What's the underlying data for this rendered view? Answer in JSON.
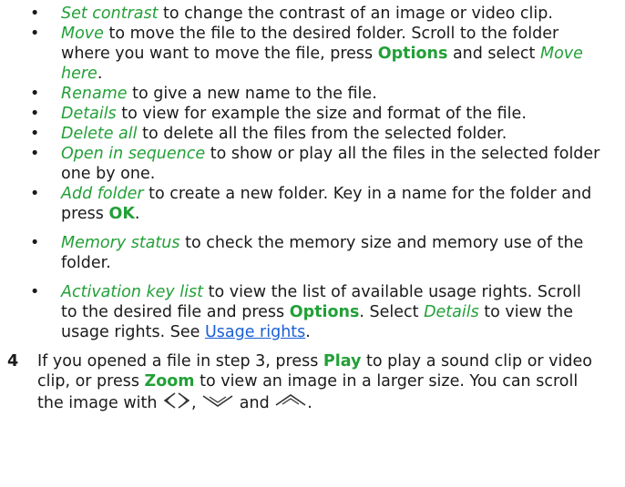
{
  "bullet_glyph": "•",
  "items": [
    {
      "option": "Set contrast",
      "text": " to change the contrast of an image or video clip."
    },
    {
      "option": "Move",
      "text1": " to move the file to the desired folder. Scroll to the folder where you want to move the file, press ",
      "key": "Options",
      "text2": " and select ",
      "option2": "Move here",
      "text3": "."
    },
    {
      "option": "Rename",
      "text": " to give a new name to the file."
    },
    {
      "option": "Details",
      "text": " to view for example the size and format of the file."
    },
    {
      "option": "Delete all",
      "text": " to delete all the files from the selected folder."
    },
    {
      "option": "Open in sequence",
      "text": " to show or play all the files in the selected folder one by one."
    },
    {
      "option": "Add folder",
      "text1": " to create a new folder. Key in a name for the folder and press ",
      "key": "OK",
      "text2": "."
    },
    {
      "option": "Memory status",
      "text": " to check the memory size and memory use of the folder."
    },
    {
      "option": "Activation key list",
      "text1": " to view the list of available usage rights. Scroll to the desired file and press ",
      "key": "Options",
      "text2": ". Select ",
      "option2": "Details",
      "text3": " to view the usage rights. See ",
      "link": "Usage rights",
      "text4": "."
    }
  ],
  "step4": {
    "number": "4",
    "text1": "If you opened a file in step 3, press ",
    "key1": "Play",
    "text2": " to play a sound clip or video clip, or press ",
    "key2": "Zoom",
    "text3": " to view an image in a larger size. You can scroll the image with ",
    "text4": ", ",
    "text5": " and ",
    "text6": "."
  },
  "icons": [
    "scroll-left-icon",
    "scroll-right-icon",
    "scroll-down-icon",
    "scroll-up-icon"
  ],
  "colors": {
    "option": "#22a037",
    "link": "#1a5fd6",
    "text": "#1a1a1a"
  }
}
